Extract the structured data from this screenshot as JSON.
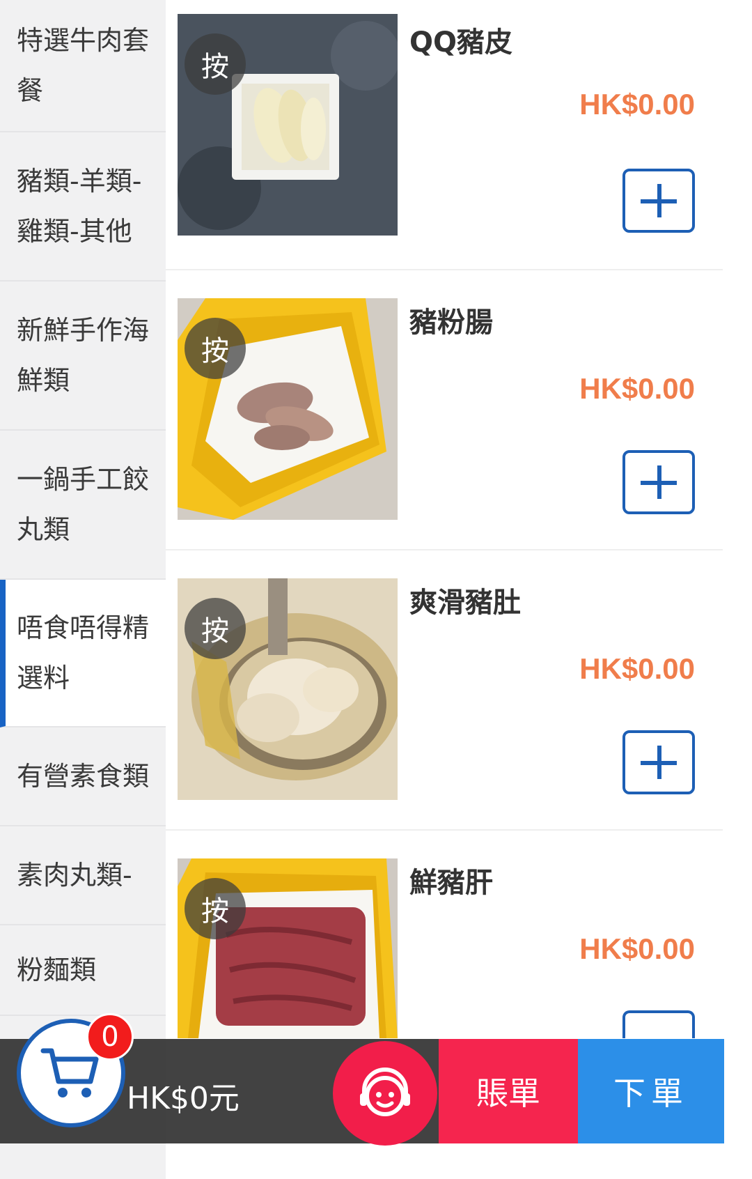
{
  "sidebar": {
    "items": [
      {
        "label": "特選牛肉套餐"
      },
      {
        "label": "豬類-羊類-雞類-其他"
      },
      {
        "label": "新鮮手作海鮮類"
      },
      {
        "label": "一鍋手工餃丸類"
      },
      {
        "label": "唔食唔得精選料",
        "active": true
      },
      {
        "label": "有營素食類"
      },
      {
        "label": "素肉丸類-"
      },
      {
        "label": "粉麵類"
      }
    ]
  },
  "products": [
    {
      "name": "QQ豬皮",
      "price": "HK$0.00",
      "press_label": "按",
      "image": "pork-skin-photo"
    },
    {
      "name": "豬粉腸",
      "price": "HK$0.00",
      "press_label": "按",
      "image": "pork-intestine-photo"
    },
    {
      "name": "爽滑豬肚",
      "price": "HK$0.00",
      "press_label": "按",
      "image": "pork-tripe-photo"
    },
    {
      "name": "鮮豬肝",
      "price": "HK$0.00",
      "press_label": "按",
      "image": "pork-liver-photo"
    }
  ],
  "cart": {
    "count": "0",
    "total": "HK$0元",
    "icon": "cart-icon"
  },
  "actions": {
    "bill_label": "賬單",
    "order_label": "下單",
    "service_icon": "customer-service-icon"
  },
  "colors": {
    "accent": "#1d5fb5",
    "price": "#f07d4b",
    "bill": "#f5254e",
    "order": "#2c8fe8"
  }
}
